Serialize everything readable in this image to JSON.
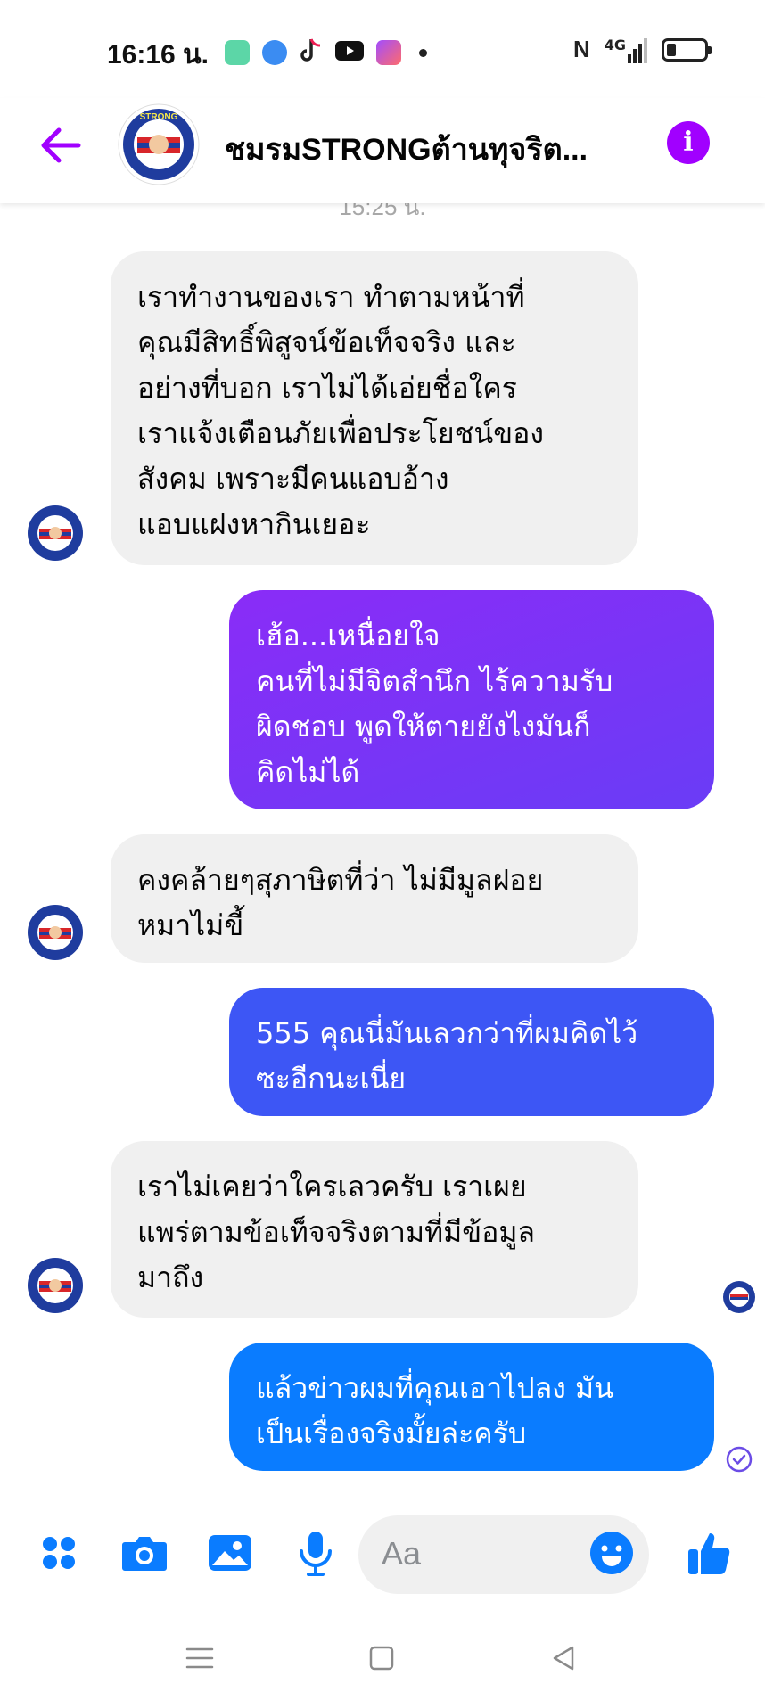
{
  "status": {
    "time": "16:16 น.",
    "apps": [
      "app-green-icon",
      "app-blue-icon",
      "tiktok-icon",
      "youtube-icon",
      "messenger-icon"
    ],
    "network": "4G",
    "nfc": "N"
  },
  "header": {
    "title": "ชมรมSTRONGต้านทุจริต...",
    "avatar_text": "STRONG",
    "accent": "#a100ff"
  },
  "thread": {
    "timestamp": "15:25 น.",
    "messages": [
      {
        "side": "received",
        "text": "เราทำงานของเรา  ทำตามหน้าที่\nคุณมีสิทธิ์พิสูจน์ข้อเท็จจริง และ\nอย่างที่บอก เราไม่ได้เอ่ยชื่อใคร\nเราแจ้งเตือนภัยเพื่อประโยชน์ของ\nสังคม เพราะมีคนแอบอ้าง\nแอบแฝงหากินเยอะ"
      },
      {
        "side": "sent",
        "text": "เฮ้อ...เหนื่อยใจ\nคนที่ไม่มีจิตสำนึก ไร้ความรับ\nผิดชอบ   พูดให้ตายยังไงมันก็\nคิดไม่ได้",
        "color": "#7b2ff7"
      },
      {
        "side": "received",
        "text": "คงคล้ายๆสุภาษิตที่ว่า ไม่มีมูลฝอย\nหมาไม่ขี้"
      },
      {
        "side": "sent",
        "text": "555 คุณนี่มันเลวกว่าที่ผมคิดไว้\nซะอีกนะเนี่ย",
        "color": "#3d56f5"
      },
      {
        "side": "received",
        "text": "เราไม่เคยว่าใครเลวครับ เราเผย\nแพร่ตามข้อเท็จจริงตามที่มีข้อมูล\nมาถึง"
      },
      {
        "side": "sent",
        "text": "แล้วข่าวผมที่คุณเอาไปลง มัน\nเป็นเรื่องจริงมั้ยล่ะครับ",
        "color": "#0a7cff"
      }
    ]
  },
  "composer": {
    "placeholder": "Aa",
    "icons": [
      "menu-dots-icon",
      "camera-icon",
      "image-icon",
      "microphone-icon",
      "emoji-icon",
      "thumbs-up-icon"
    ],
    "accent": "#0a7cff"
  },
  "nav": {
    "icons": [
      "recent-apps-icon",
      "home-icon",
      "back-nav-icon"
    ]
  }
}
